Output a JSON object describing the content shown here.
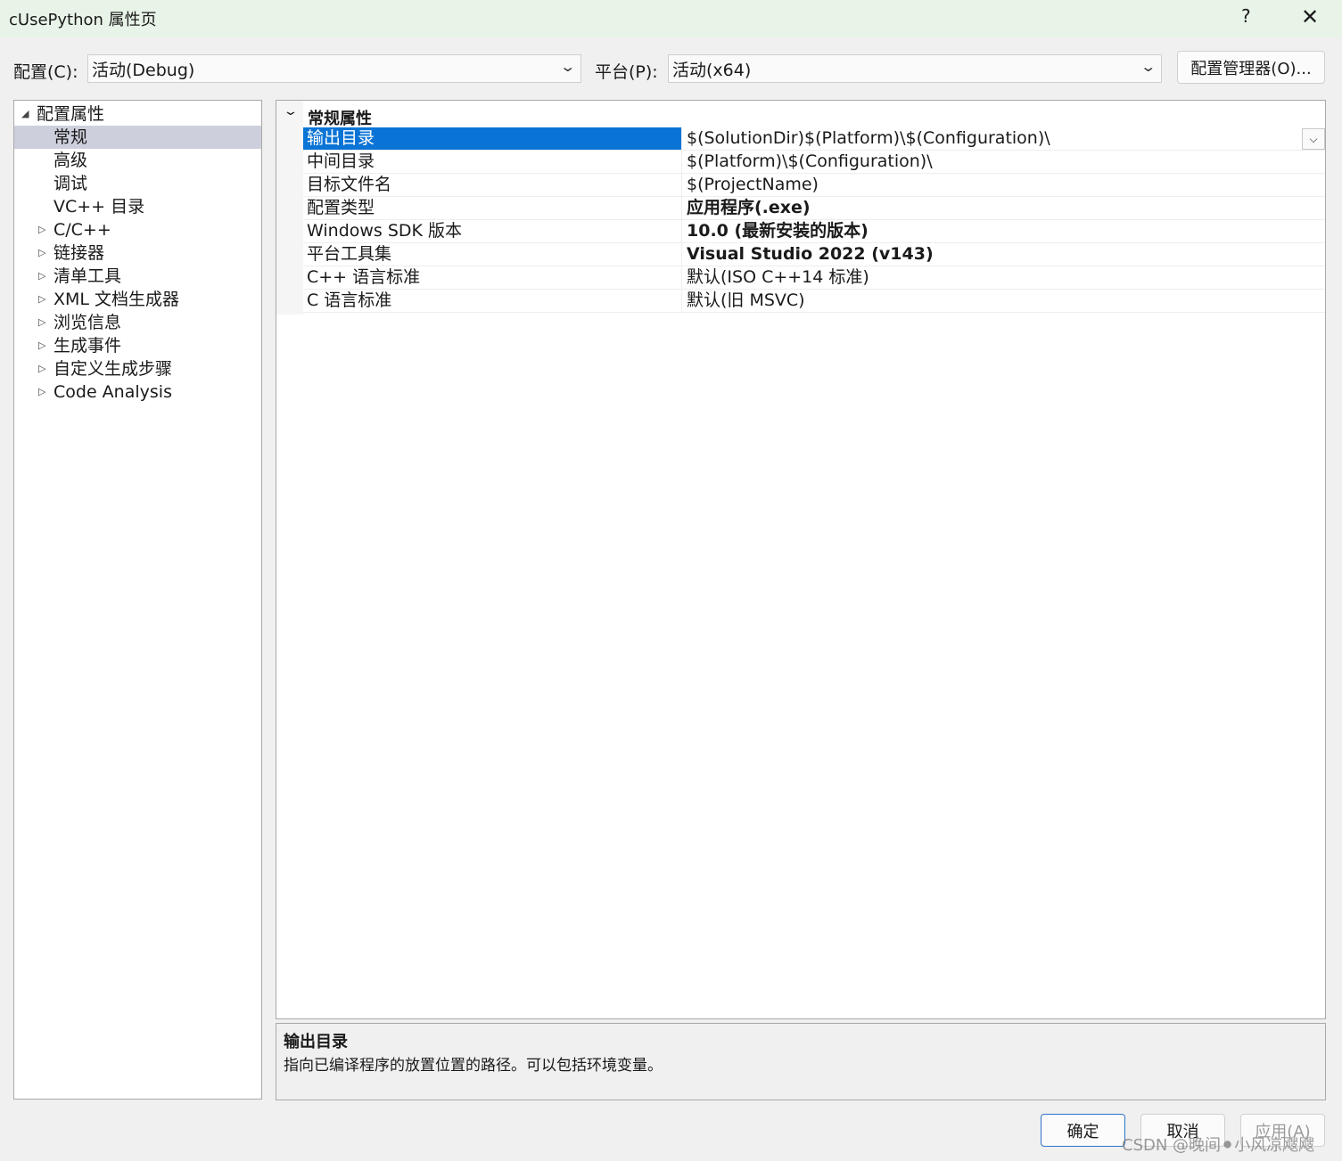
{
  "window": {
    "title": "cUsePython 属性页",
    "help": "?",
    "close": "✕"
  },
  "config": {
    "label": "配置(C):",
    "value": "活动(Debug)"
  },
  "platform": {
    "label": "平台(P):",
    "value": "活动(x64)"
  },
  "config_manager": "配置管理器(O)...",
  "tree": {
    "root": "配置属性",
    "children": [
      "常规",
      "高级",
      "调试",
      "VC++ 目录"
    ],
    "collapsed": [
      "C/C++",
      "链接器",
      "清单工具",
      "XML 文档生成器",
      "浏览信息",
      "生成事件",
      "自定义生成步骤",
      "Code Analysis"
    ],
    "selected": "常规"
  },
  "grid": {
    "category": "常规属性",
    "rows": [
      {
        "name": "输出目录",
        "value": "$(SolutionDir)$(Platform)\\$(Configuration)\\"
      },
      {
        "name": "中间目录",
        "value": "$(Platform)\\$(Configuration)\\"
      },
      {
        "name": "目标文件名",
        "value": "$(ProjectName)"
      },
      {
        "name": "配置类型",
        "value": "应用程序(.exe)"
      },
      {
        "name": "Windows SDK 版本",
        "value": "10.0 (最新安装的版本)"
      },
      {
        "name": "平台工具集",
        "value": "Visual Studio 2022 (v143)"
      },
      {
        "name": "C++ 语言标准",
        "value": "默认(ISO C++14 标准)"
      },
      {
        "name": "C 语言标准",
        "value": "默认(旧 MSVC)"
      }
    ],
    "selected": "输出目录"
  },
  "description": {
    "title": "输出目录",
    "text": "指向已编译程序的放置位置的路径。可以包括环境变量。"
  },
  "buttons": {
    "ok": "确定",
    "cancel": "取消",
    "apply": "应用(A)"
  },
  "watermark": "CSDN @晚间⚫小风凉飕飕"
}
